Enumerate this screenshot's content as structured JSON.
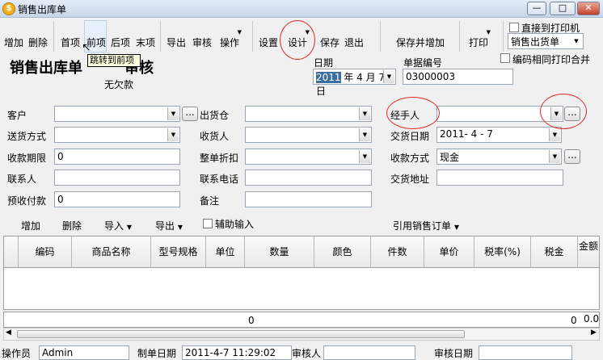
{
  "window": {
    "title": "销售出库单",
    "min_glyph": "—",
    "max_glyph": "□",
    "close_glyph": "✕"
  },
  "toolbar": {
    "add": "增加",
    "delete": "删除",
    "first": "首项",
    "prev": "前项",
    "next": "后项",
    "last": "末项",
    "export": "导出",
    "audit": "审核",
    "operate": "操作",
    "settings": "设置",
    "design": "设计",
    "save": "保存",
    "exit": "退出",
    "save_add": "保存并增加",
    "print": "打印",
    "direct_print_label": "直接到打印机",
    "print_template": "销售出货单",
    "same_number_merge": "编码相同打印合并"
  },
  "tooltip": "跳转到前项",
  "header": {
    "doc_title": "销售出库单",
    "doc_title_suffix": "审核",
    "status": "无欠款",
    "date_label": "日期",
    "date_year": "2011",
    "date_rest": " 年 4 月 7 日",
    "doc_no_label": "单据编号",
    "doc_no": "03000003"
  },
  "form": {
    "customer_label": "客户",
    "customer": "",
    "warehouse_label": "出货仓",
    "warehouse": "",
    "handler_label": "经手人",
    "handler": "",
    "delivery_method_label": "送货方式",
    "delivery_method": "",
    "receiver_label": "收货人",
    "receiver": "",
    "delivery_date_label": "交货日期",
    "delivery_date": "2011- 4 - 7",
    "pay_limit_label": "收款期限",
    "pay_limit": "0",
    "discount_label": "整单折扣",
    "discount": "",
    "pay_method_label": "收款方式",
    "pay_method": "现金",
    "contact_label": "联系人",
    "contact": "",
    "phone_label": "联系电话",
    "phone": "",
    "address_label": "交货地址",
    "address": "",
    "prepaid_label": "预收付款",
    "prepaid": "0",
    "remark_label": "备注",
    "remark": ""
  },
  "grid_toolbar": {
    "add": "增加",
    "delete": "删除",
    "import": "导入",
    "export": "导出",
    "assist_input": "辅助输入",
    "ref_order": "引用销售订单"
  },
  "grid": {
    "columns": [
      "编码",
      "商品名称",
      "型号规格",
      "单位",
      "数量",
      "颜色",
      "件数",
      "单价",
      "税率(%)",
      "税金",
      "金额"
    ],
    "sum_qty": "0",
    "sum_tax": "0",
    "sum_amount": "0.0"
  },
  "statusbar": {
    "operator_label": "操作员",
    "operator": "Admin",
    "created_label": "制单日期",
    "created": "2011-4-7 11:29:02",
    "auditor_label": "审核人",
    "auditor": "",
    "audit_date_label": "审核日期",
    "audit_date": ""
  }
}
